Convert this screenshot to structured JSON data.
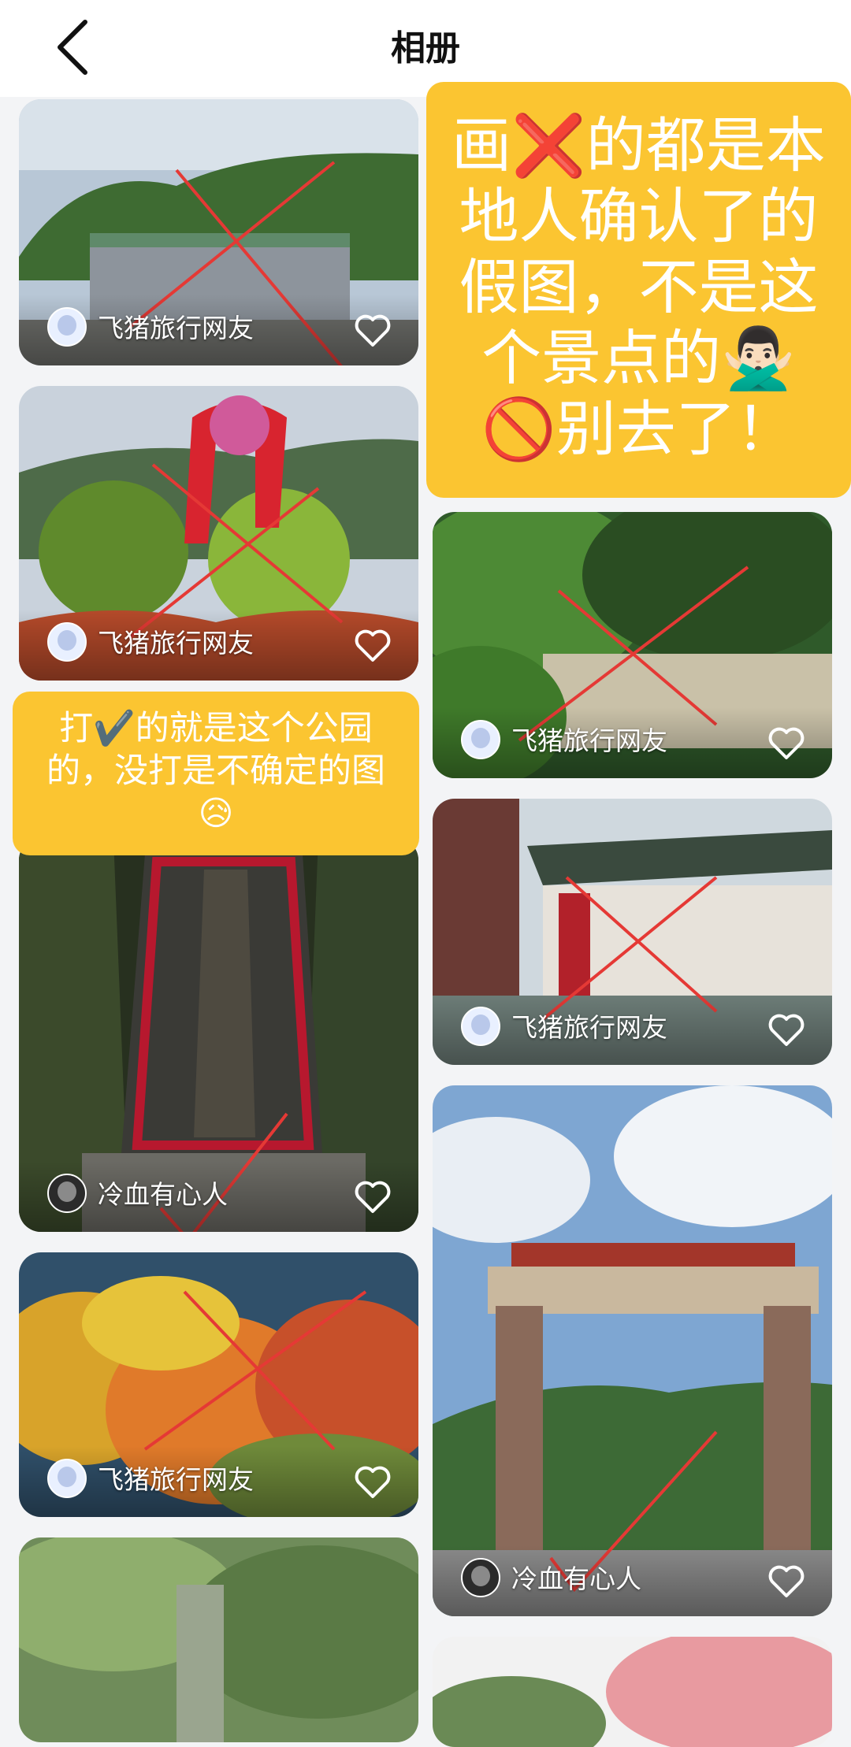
{
  "header": {
    "title": "相册",
    "back_icon": "back-arrow-icon"
  },
  "cards": [
    {
      "user": "飞猪旅行网友",
      "liked": false
    },
    {
      "user": "飞猪旅行网友",
      "liked": false
    },
    {
      "user": "冷血有心人",
      "liked": false
    },
    {
      "user": "飞猪旅行网友",
      "liked": false
    },
    {
      "user": "飞猪旅行网友",
      "liked": false
    },
    {
      "user": "飞猪旅行网友",
      "liked": false
    },
    {
      "user": "冷血有心人",
      "liked": false
    }
  ],
  "notes": {
    "big": "画❌的都是本\n地人确认了的\n假图，不是这\n个景点的🙅🏻‍♂️\n🚫别去了！",
    "small": "打✔️的就是这个公园\n的，没打是不确定的图\n😥"
  },
  "colors": {
    "note_bg": "#fbc531",
    "mark_red": "#e53935"
  }
}
